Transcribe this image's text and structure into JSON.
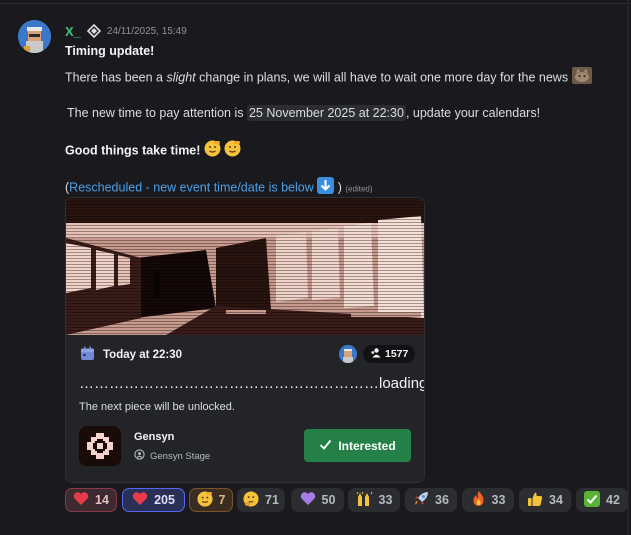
{
  "message": {
    "author": "X_",
    "timestamp": "24/11/2025, 15:49",
    "heading": "Timing update!",
    "line1_pre": "There has been a ",
    "line1_italic": "slight",
    "line1_post": " change in plans, we will all have to wait one more day for the news",
    "line2_pre": "The new time to pay attention is ",
    "line2_code": "25 November 2025 at 22:30",
    "line2_post": ", update your calendars!",
    "line3": "Good things take time!",
    "link_open": "(",
    "link_text": "Rescheduled - new event time/date is below",
    "link_close": ")",
    "edited": "(edited)"
  },
  "event": {
    "time": "Today at 22:30",
    "interested_count": "1577",
    "title": "……………………………………………………loading",
    "description": "The next piece will be unlocked.",
    "server_name": "Gensyn",
    "stage_name": "Gensyn Stage",
    "interested_label": "Interested"
  },
  "reactions": [
    {
      "emoji": "red-heart",
      "count": "14"
    },
    {
      "emoji": "red-heart",
      "count": "205"
    },
    {
      "emoji": "saluting-face",
      "count": "7"
    },
    {
      "emoji": "thinking-face",
      "count": "71"
    },
    {
      "emoji": "purple-heart",
      "count": "50"
    },
    {
      "emoji": "raising-hands",
      "count": "33"
    },
    {
      "emoji": "rocket",
      "count": "36"
    },
    {
      "emoji": "fire",
      "count": "33"
    },
    {
      "emoji": "thumbs-up",
      "count": "34"
    },
    {
      "emoji": "check-mark-button",
      "count": "42"
    }
  ],
  "colors": {
    "accent_green": "#248046",
    "username": "#3ec27a",
    "link": "#4a9fe8",
    "blurple": "#5865f2"
  }
}
